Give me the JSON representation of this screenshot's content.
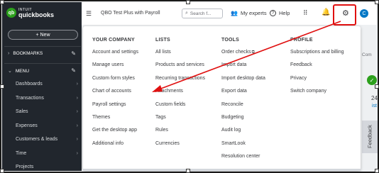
{
  "sidebar": {
    "logo_badge": "qb",
    "logo_line1": "INTUIT",
    "logo_line2": "quickbooks",
    "new_label": "+ New",
    "bookmarks_label": "BOOKMARKS",
    "menu_label": "MENU",
    "items": [
      {
        "label": "Dashboards"
      },
      {
        "label": "Transactions"
      },
      {
        "label": "Sales"
      },
      {
        "label": "Expenses"
      },
      {
        "label": "Customers & leads"
      },
      {
        "label": "Time"
      },
      {
        "label": "Projects"
      }
    ]
  },
  "topbar": {
    "company_name": "QBO Test Plus with Payroll",
    "search_placeholder": "Search f...",
    "experts_label": "My experts",
    "help_label": "Help",
    "avatar_initial": "C"
  },
  "background": {
    "comp_text": "Com",
    "number_text": "24",
    "link_text": "ist",
    "feedback_label": "Feedback"
  },
  "dropdown": {
    "your_company": {
      "heading": "YOUR COMPANY",
      "items": [
        "Account and settings",
        "Manage users",
        "Custom form styles",
        "Chart of accounts",
        "Payroll settings",
        "Themes",
        "Get the desktop app",
        "Additional info"
      ]
    },
    "lists": {
      "heading": "LISTS",
      "items": [
        "All lists",
        "Products and services",
        "Recurring transactions",
        "Attachments",
        "Custom fields",
        "Tags",
        "Rules",
        "Currencies"
      ]
    },
    "tools": {
      "heading": "TOOLS",
      "items": [
        "Order checks",
        "Import data",
        "Import desktop data",
        "Export data",
        "Reconcile",
        "Budgeting",
        "Audit log",
        "SmartLook",
        "Resolution center"
      ]
    },
    "profile": {
      "heading": "PROFILE",
      "items": [
        "Subscriptions and billing",
        "Feedback",
        "Privacy",
        "Switch company"
      ]
    }
  },
  "colors": {
    "sidebar_bg": "#21262d",
    "brand_green": "#2ca01c",
    "annotation_red": "#e01010",
    "link_blue": "#0077c5"
  }
}
